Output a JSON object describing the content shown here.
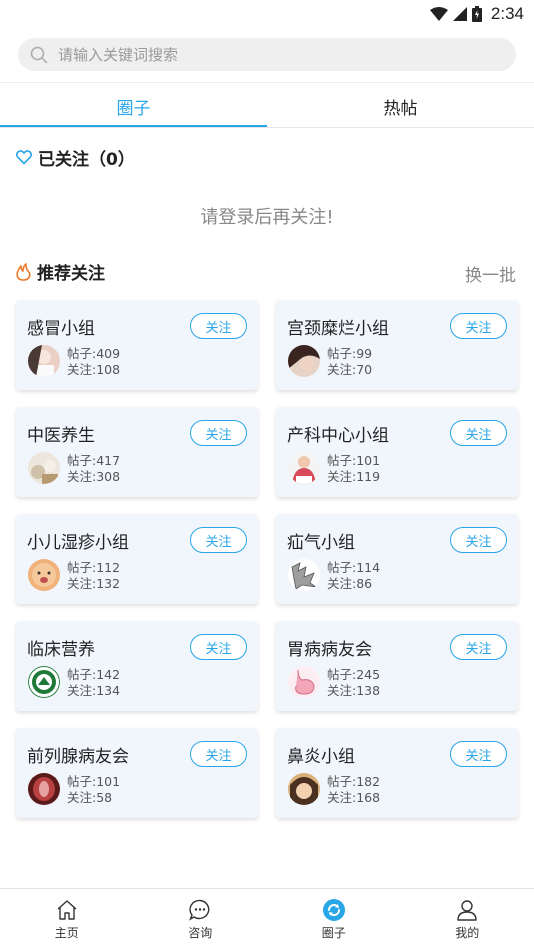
{
  "status_bar": {
    "time": "2:34"
  },
  "search": {
    "placeholder": "请输入关键词搜索"
  },
  "tabs": [
    {
      "label": "圈子",
      "active": true
    },
    {
      "label": "热帖",
      "active": false
    }
  ],
  "followed": {
    "title": "已关注（0）",
    "empty_hint": "请登录后再关注!"
  },
  "recommended": {
    "title": "推荐关注",
    "refresh_label": "换一批"
  },
  "follow_label": "关注",
  "groups": [
    {
      "name": "感冒小组",
      "posts": "帖子:409",
      "follows": "关注:108",
      "avatar_color": "#e9cfc4"
    },
    {
      "name": "宫颈糜烂小组",
      "posts": "帖子:99",
      "follows": "关注:70",
      "avatar_color": "#5a3a30"
    },
    {
      "name": "中医养生",
      "posts": "帖子:417",
      "follows": "关注:308",
      "avatar_color": "#d9c9b0"
    },
    {
      "name": "产科中心小组",
      "posts": "帖子:101",
      "follows": "关注:119",
      "avatar_color": "#d94a5a"
    },
    {
      "name": "小儿湿疹小组",
      "posts": "帖子:112",
      "follows": "关注:132",
      "avatar_color": "#f0b27a"
    },
    {
      "name": "疝气小组",
      "posts": "帖子:114",
      "follows": "关注:86",
      "avatar_color": "#bdbdbd"
    },
    {
      "name": "临床营养",
      "posts": "帖子:142",
      "follows": "关注:134",
      "avatar_color": "#1f7a3a"
    },
    {
      "name": "胃病病友会",
      "posts": "帖子:245",
      "follows": "关注:138",
      "avatar_color": "#f2a6b8"
    },
    {
      "name": "前列腺病友会",
      "posts": "帖子:101",
      "follows": "关注:58",
      "avatar_color": "#8a2a2a"
    },
    {
      "name": "鼻炎小组",
      "posts": "帖子:182",
      "follows": "关注:168",
      "avatar_color": "#c79a5a"
    }
  ],
  "bottom_nav": [
    {
      "label": "主页",
      "icon": "home-icon"
    },
    {
      "label": "咨询",
      "icon": "chat-icon"
    },
    {
      "label": "圈子",
      "icon": "circle-icon",
      "active": true
    },
    {
      "label": "我的",
      "icon": "user-icon"
    }
  ],
  "colors": {
    "accent": "#29a6e8",
    "card_bg": "#f1f6fd",
    "flame": "#f07a2a"
  }
}
